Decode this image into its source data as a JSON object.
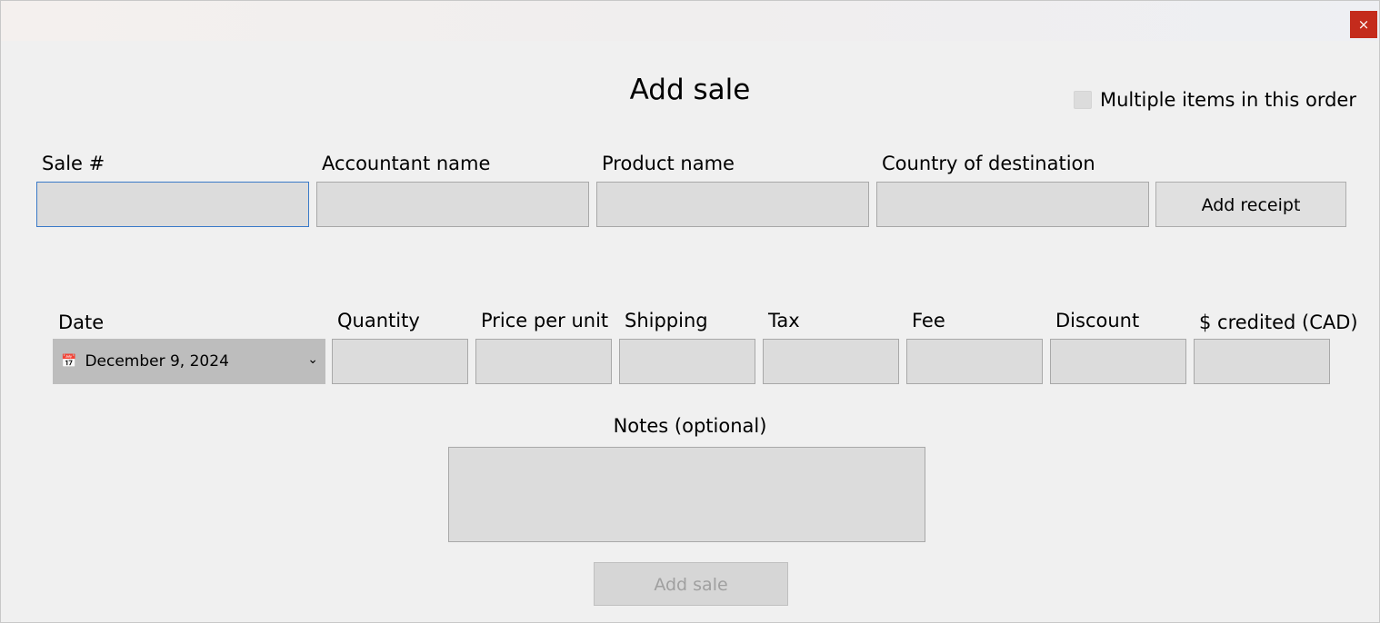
{
  "window": {
    "close_label": "×"
  },
  "dialog": {
    "title": "Add sale",
    "multiple_items_label": "Multiple items in this order",
    "multiple_items_checked": false
  },
  "row1": {
    "sale_number_label": "Sale #",
    "sale_number_value": "",
    "accountant_label": "Accountant name",
    "accountant_value": "",
    "product_label": "Product name",
    "product_value": "",
    "country_label": "Country of destination",
    "country_value": "",
    "add_receipt_label": "Add receipt"
  },
  "row2": {
    "date_label": "Date",
    "date_value": "December 9, 2024",
    "quantity_label": "Quantity",
    "price_label": "Price per unit",
    "shipping_label": "Shipping",
    "tax_label": "Tax",
    "fee_label": "Fee",
    "discount_label": "Discount",
    "credited_label": "$ credited (CAD)"
  },
  "notes": {
    "label": "Notes (optional)",
    "value": ""
  },
  "actions": {
    "add_sale_label": "Add sale",
    "add_sale_enabled": false
  },
  "icons": {
    "close": "close-icon",
    "calendar": "calendar-icon",
    "chevron": "chevron-down-icon"
  },
  "colors": {
    "close_bg": "#c42b1c",
    "focus_border": "#3a7ac8",
    "field_bg": "#dcdcdc",
    "window_bg": "#f0f0f0"
  }
}
